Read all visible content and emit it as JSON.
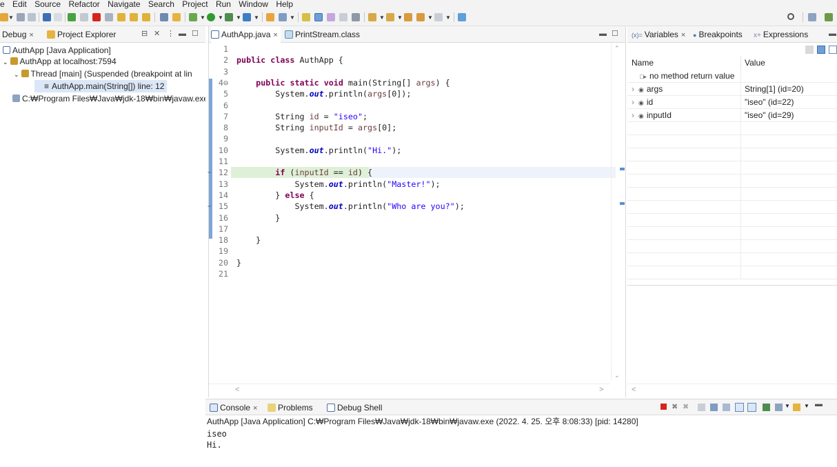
{
  "menu": [
    "e",
    "Edit",
    "Source",
    "Refactor",
    "Navigate",
    "Search",
    "Project",
    "Run",
    "Window",
    "Help"
  ],
  "colors": {
    "keyword": "#7f0055",
    "string": "#2a00ff",
    "field": "#0000c0",
    "highlight": "#dff0d8",
    "selection": "#dbe7f7",
    "accent": "#0b6acb"
  },
  "debug": {
    "tabs": [
      {
        "label": "Debug",
        "close": "×"
      },
      {
        "label": "Project Explorer"
      }
    ],
    "tree": [
      {
        "label": "AuthApp [Java Application]",
        "icon": "java-app-icon"
      },
      {
        "label": "AuthApp at localhost:7594",
        "icon": "debug-target-icon",
        "expanded": true
      },
      {
        "label": "Thread [main] (Suspended (breakpoint at lin",
        "icon": "thread-icon",
        "expanded": true
      },
      {
        "label": "AuthApp.main(String[]) line: 12",
        "icon": "stack-frame-icon",
        "selected": true
      },
      {
        "label": "C:₩Program Files₩Java₩jdk-18₩bin₩javaw.exe (",
        "icon": "process-icon"
      }
    ]
  },
  "editor": {
    "tabs": [
      {
        "label": "AuthApp.java",
        "close": "×",
        "active": true
      },
      {
        "label": "PrintStream.class"
      }
    ],
    "current_line": 12,
    "breakpoint_lines": [
      12,
      15
    ],
    "lines": [
      {
        "n": "1",
        "code": ""
      },
      {
        "n": "2",
        "code": "public class AuthApp {"
      },
      {
        "n": "3",
        "code": ""
      },
      {
        "n": "4⊖",
        "code": "    public static void main(String[] args) {"
      },
      {
        "n": "5",
        "code": "        System.out.println(args[0]);"
      },
      {
        "n": "6",
        "code": ""
      },
      {
        "n": "7",
        "code": "        String id = \"iseo\";"
      },
      {
        "n": "8",
        "code": "        String inputId = args[0];"
      },
      {
        "n": "9",
        "code": ""
      },
      {
        "n": "10",
        "code": "        System.out.println(\"Hi.\");"
      },
      {
        "n": "11",
        "code": ""
      },
      {
        "n": "12",
        "code": "        if (inputId == id) {"
      },
      {
        "n": "13",
        "code": "            System.out.println(\"Master!\");"
      },
      {
        "n": "14",
        "code": "        } else {"
      },
      {
        "n": "15",
        "code": "            System.out.println(\"Who are you?\");"
      },
      {
        "n": "16",
        "code": "        }"
      },
      {
        "n": "17",
        "code": ""
      },
      {
        "n": "18",
        "code": "    }"
      },
      {
        "n": "19",
        "code": ""
      },
      {
        "n": "20",
        "code": "}"
      },
      {
        "n": "21",
        "code": ""
      }
    ]
  },
  "variables": {
    "tabs": [
      {
        "label": "Variables",
        "close": "×"
      },
      {
        "label": "Breakpoints"
      },
      {
        "label": "Expressions"
      }
    ],
    "columns": {
      "name": "Name",
      "value": "Value"
    },
    "rows": [
      {
        "name": "no method return value",
        "value": "",
        "expandable": false,
        "icon": "return-value-icon"
      },
      {
        "name": "args",
        "value": "String[1]  (id=20)",
        "expandable": true
      },
      {
        "name": "id",
        "value": "\"iseo\" (id=22)",
        "expandable": true
      },
      {
        "name": "inputId",
        "value": "\"iseo\" (id=29)",
        "expandable": true
      }
    ]
  },
  "console": {
    "tabs": [
      {
        "label": "Console",
        "close": "×"
      },
      {
        "label": "Problems"
      },
      {
        "label": "Debug Shell"
      }
    ],
    "launch_info": "AuthApp [Java Application] C:₩Program Files₩Java₩jdk-18₩bin₩javaw.exe  (2022. 4. 25. 오후 8:08:33) [pid: 14280]",
    "output": [
      "iseo",
      "Hi."
    ]
  }
}
